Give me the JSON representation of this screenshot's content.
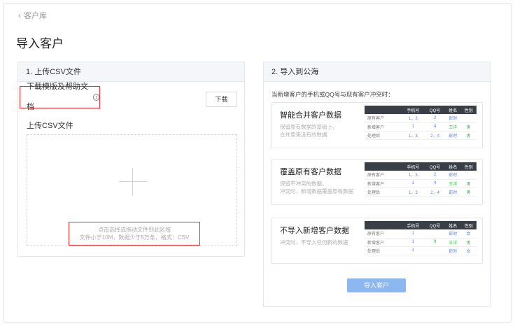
{
  "nav": {
    "back_label": "客户库"
  },
  "page": {
    "title": "导入客户"
  },
  "upload": {
    "header": "1. 上传CSV文件",
    "template_link": "下载模版及帮助文档",
    "download_button": "下载",
    "upload_label": "上传CSV文件",
    "hint_line1": "点击选择或拖动文件到此区域",
    "hint_line2": "文件小于10M，数据少于5万条，格式：CSV"
  },
  "public_sea": {
    "header": "2. 导入到公海",
    "conflict_label": "当新增客户的手机或QQ号与现有客户冲突时：",
    "table_headers": [
      "",
      "手机号",
      "QQ号",
      "姓名",
      "性别"
    ],
    "options": [
      {
        "title": "智能合并客户数据",
        "desc1": "保留原有数据的基础上，",
        "desc2": "合并原来没有的数据",
        "rows": [
          [
            "原有客户",
            "1，3",
            "2",
            "彭时",
            ""
          ],
          [
            "新增客户",
            "1",
            "4",
            "王洋",
            "男"
          ],
          [
            "处理后",
            "1，3",
            "2，4",
            "彭时",
            "男"
          ]
        ]
      },
      {
        "title": "覆盖原有客户数据",
        "desc1": "保留不冲突的数据，",
        "desc2": "冲突时，新增数据覆盖原有数据",
        "rows": [
          [
            "原有客户",
            "1，3",
            "2",
            "彭时",
            ""
          ],
          [
            "新增客户",
            "1",
            "4",
            "王洋",
            "男"
          ],
          [
            "处理后",
            "1，3",
            "2，4",
            "彭时",
            "男"
          ]
        ]
      },
      {
        "title": "不导入新增客户数据",
        "desc1": "冲突时，不导入任何新的数据",
        "desc2": "",
        "rows": [
          [
            "原有客户",
            "1",
            "",
            "彭时",
            "女"
          ],
          [
            "新增客户",
            "1",
            "9",
            "王洋",
            "男"
          ],
          [
            "处理后",
            "1",
            "",
            "彭时",
            "女"
          ]
        ]
      }
    ],
    "submit_button": "导入客户"
  },
  "colors": {
    "accent": "#8cb7f0",
    "highlight": "#e03030",
    "table_head": "#3a3f47",
    "link": "#5b7fd6",
    "green": "#3bb54a"
  },
  "icons": {
    "back": "chevron-left-icon",
    "info": "info-circle-icon",
    "upload": "plus-icon"
  }
}
